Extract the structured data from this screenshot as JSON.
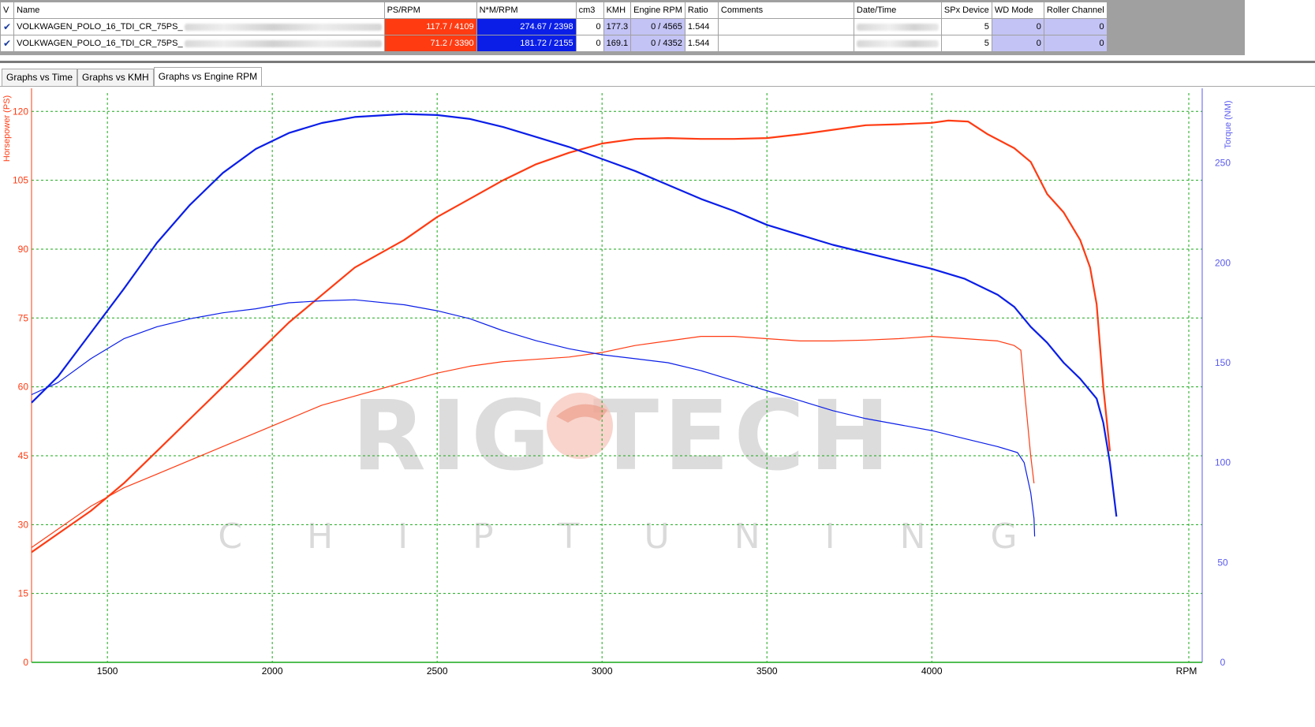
{
  "grid": {
    "columns": [
      "V",
      "Name",
      "PS/RPM",
      "N*M/RPM",
      "cm3",
      "KMH",
      "Engine RPM",
      "Ratio",
      "Comments",
      "Date/Time",
      "SPx Device",
      "WD Mode",
      "Roller Channel"
    ],
    "rows": [
      {
        "checked": "✔",
        "name": "VOLKWAGEN_POLO_16_TDI_CR_75PS_",
        "ps": "117.7 / 4109",
        "nm": "274.67 / 2398",
        "cm3": "0",
        "kmh": "177.3",
        "engine_rpm": "0 / 4565",
        "ratio": "1.544",
        "comments": "",
        "spx": "5",
        "wd": "0",
        "roller": "0"
      },
      {
        "checked": "✔",
        "name": "VOLKWAGEN_POLO_16_TDI_CR_75PS_",
        "ps": "71.2 / 3390",
        "nm": "181.72 / 2155",
        "cm3": "0",
        "kmh": "169.1",
        "engine_rpm": "0 / 4352",
        "ratio": "1.544",
        "comments": "",
        "spx": "5",
        "wd": "0",
        "roller": "0"
      }
    ]
  },
  "tabs": [
    {
      "label": "Graphs vs Time",
      "active": false
    },
    {
      "label": "Graphs vs KMH",
      "active": false
    },
    {
      "label": "Graphs vs Engine RPM",
      "active": true
    }
  ],
  "colors": {
    "power": "#ff3b12",
    "torque": "#0a1ee8",
    "torque_axis": "#5a5af0",
    "grid": "#1aa81a",
    "watermark": "#d6d6d6",
    "watermark_accent": "#f0a090"
  },
  "watermark": {
    "brand": "RIG TECH",
    "sub": "C H I P T U N I N G"
  },
  "chart_data": {
    "type": "line",
    "xlabel": "RPM",
    "ylabel_left": "Horsepower (PS)",
    "ylabel_right": "Torque (NM)",
    "xlim": [
      1270,
      4820
    ],
    "ylim_left": [
      0,
      124
    ],
    "ylim_right": [
      0,
      285
    ],
    "x_ticks": [
      1500,
      2000,
      2500,
      3000,
      3500,
      4000
    ],
    "y_ticks_left": [
      0,
      15,
      30,
      45,
      60,
      75,
      90,
      105,
      120
    ],
    "y_ticks_right": [
      0,
      50,
      100,
      150,
      200,
      250
    ],
    "grid": true,
    "series": [
      {
        "kind": "power",
        "axis": "left",
        "width": 2.2,
        "points": [
          [
            1270,
            24
          ],
          [
            1350,
            28
          ],
          [
            1450,
            33
          ],
          [
            1550,
            39
          ],
          [
            1650,
            46
          ],
          [
            1750,
            53
          ],
          [
            1850,
            60
          ],
          [
            1950,
            67
          ],
          [
            2050,
            74
          ],
          [
            2150,
            80
          ],
          [
            2250,
            86
          ],
          [
            2400,
            92
          ],
          [
            2500,
            97
          ],
          [
            2600,
            101
          ],
          [
            2700,
            105
          ],
          [
            2800,
            108.5
          ],
          [
            2900,
            111
          ],
          [
            3000,
            113
          ],
          [
            3100,
            114
          ],
          [
            3200,
            114.2
          ],
          [
            3300,
            114
          ],
          [
            3400,
            114
          ],
          [
            3500,
            114.2
          ],
          [
            3600,
            115
          ],
          [
            3700,
            116
          ],
          [
            3800,
            117
          ],
          [
            3900,
            117.2
          ],
          [
            4000,
            117.5
          ],
          [
            4050,
            118
          ],
          [
            4110,
            117.8
          ],
          [
            4170,
            115
          ],
          [
            4250,
            112
          ],
          [
            4300,
            109
          ],
          [
            4350,
            102
          ],
          [
            4400,
            98
          ],
          [
            4450,
            92
          ],
          [
            4480,
            86
          ],
          [
            4500,
            78
          ],
          [
            4520,
            60
          ],
          [
            4540,
            46
          ]
        ]
      },
      {
        "kind": "torque",
        "axis": "right",
        "width": 2.2,
        "points": [
          [
            1270,
            130
          ],
          [
            1350,
            143
          ],
          [
            1450,
            165
          ],
          [
            1550,
            187
          ],
          [
            1650,
            210
          ],
          [
            1750,
            229
          ],
          [
            1850,
            245
          ],
          [
            1950,
            257
          ],
          [
            2050,
            265
          ],
          [
            2150,
            270
          ],
          [
            2250,
            273
          ],
          [
            2400,
            274.5
          ],
          [
            2500,
            274
          ],
          [
            2600,
            272
          ],
          [
            2700,
            268
          ],
          [
            2800,
            263
          ],
          [
            2900,
            258
          ],
          [
            3000,
            252
          ],
          [
            3100,
            246
          ],
          [
            3200,
            239
          ],
          [
            3300,
            232
          ],
          [
            3400,
            226
          ],
          [
            3500,
            219
          ],
          [
            3600,
            214
          ],
          [
            3700,
            209
          ],
          [
            3800,
            205
          ],
          [
            3900,
            201
          ],
          [
            4000,
            197
          ],
          [
            4100,
            192
          ],
          [
            4200,
            184
          ],
          [
            4250,
            178
          ],
          [
            4300,
            168
          ],
          [
            4350,
            160
          ],
          [
            4400,
            150
          ],
          [
            4450,
            142
          ],
          [
            4500,
            132
          ],
          [
            4520,
            120
          ],
          [
            4540,
            100
          ],
          [
            4560,
            73
          ]
        ]
      },
      {
        "kind": "power",
        "axis": "left",
        "width": 1.2,
        "points": [
          [
            1270,
            25
          ],
          [
            1350,
            29
          ],
          [
            1450,
            34
          ],
          [
            1550,
            38
          ],
          [
            1650,
            41
          ],
          [
            1750,
            44
          ],
          [
            1850,
            47
          ],
          [
            1950,
            50
          ],
          [
            2050,
            53
          ],
          [
            2150,
            56
          ],
          [
            2250,
            58
          ],
          [
            2400,
            61
          ],
          [
            2500,
            63
          ],
          [
            2600,
            64.5
          ],
          [
            2700,
            65.5
          ],
          [
            2800,
            66
          ],
          [
            2900,
            66.5
          ],
          [
            3000,
            67.5
          ],
          [
            3100,
            69
          ],
          [
            3200,
            70
          ],
          [
            3300,
            71
          ],
          [
            3400,
            71
          ],
          [
            3500,
            70.5
          ],
          [
            3600,
            70
          ],
          [
            3700,
            70
          ],
          [
            3800,
            70.2
          ],
          [
            3900,
            70.5
          ],
          [
            4000,
            71
          ],
          [
            4100,
            70.5
          ],
          [
            4200,
            70
          ],
          [
            4250,
            69
          ],
          [
            4270,
            68
          ],
          [
            4280,
            60
          ],
          [
            4300,
            45
          ],
          [
            4310,
            39
          ]
        ]
      },
      {
        "kind": "torque",
        "axis": "right",
        "width": 1.2,
        "points": [
          [
            1270,
            134
          ],
          [
            1350,
            140
          ],
          [
            1450,
            152
          ],
          [
            1550,
            162
          ],
          [
            1650,
            168
          ],
          [
            1750,
            172
          ],
          [
            1850,
            175
          ],
          [
            1950,
            177
          ],
          [
            2050,
            180
          ],
          [
            2150,
            181
          ],
          [
            2250,
            181.5
          ],
          [
            2400,
            179
          ],
          [
            2500,
            176
          ],
          [
            2600,
            172
          ],
          [
            2700,
            166
          ],
          [
            2800,
            161
          ],
          [
            2900,
            157
          ],
          [
            3000,
            154
          ],
          [
            3100,
            152
          ],
          [
            3200,
            150
          ],
          [
            3300,
            146
          ],
          [
            3400,
            141
          ],
          [
            3500,
            136
          ],
          [
            3600,
            131
          ],
          [
            3700,
            126
          ],
          [
            3800,
            122
          ],
          [
            3900,
            119
          ],
          [
            4000,
            116
          ],
          [
            4100,
            112
          ],
          [
            4200,
            108
          ],
          [
            4260,
            105
          ],
          [
            4280,
            100
          ],
          [
            4300,
            85
          ],
          [
            4310,
            72
          ],
          [
            4312,
            63
          ]
        ]
      }
    ]
  }
}
